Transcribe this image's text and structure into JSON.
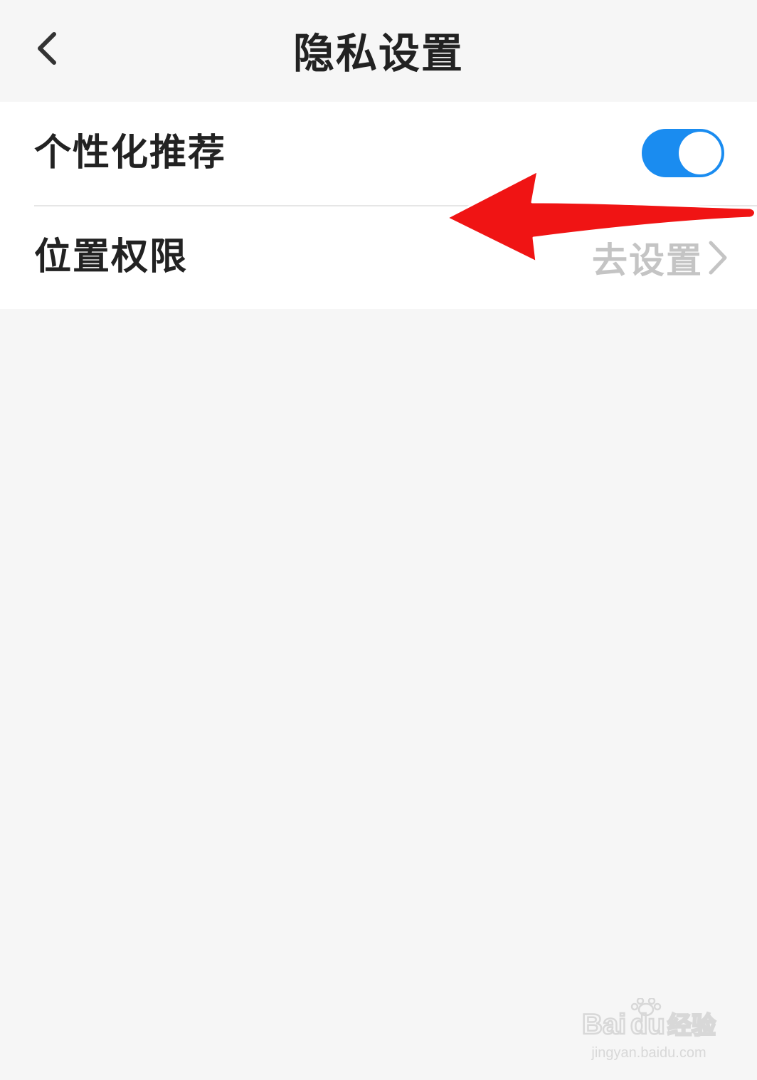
{
  "header": {
    "title": "隐私设置",
    "back_icon": "chevron-left-icon"
  },
  "settings": [
    {
      "label": "个性化推荐",
      "control": "toggle",
      "enabled": true
    },
    {
      "label": "位置权限",
      "action_label": "去设置",
      "action_icon": "chevron-right-icon"
    }
  ],
  "colors": {
    "toggle_on": "#1a8cf0",
    "annotation_arrow": "#f01414",
    "background": "#f6f6f6",
    "card": "#ffffff"
  },
  "watermark": {
    "logo_text": "Bai du 经验",
    "url": "jingyan.baidu.com"
  }
}
